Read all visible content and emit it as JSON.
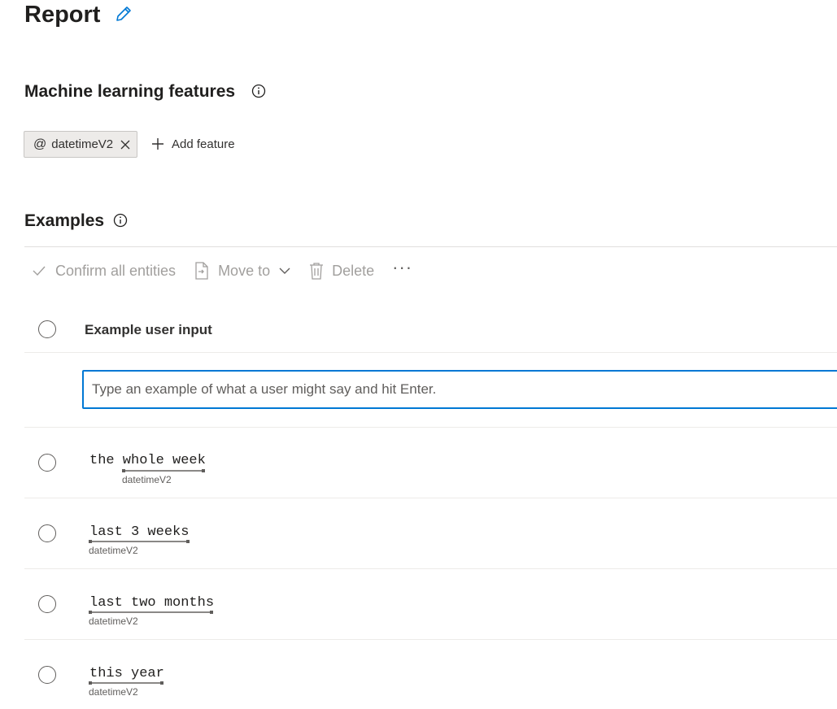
{
  "header": {
    "title": "Report"
  },
  "features": {
    "title": "Machine learning features",
    "chips": [
      {
        "prefix": "@",
        "label": "datetimeV2"
      }
    ],
    "add_label": "Add feature"
  },
  "examples": {
    "title": "Examples",
    "toolbar": {
      "confirm_label": "Confirm all entities",
      "move_label": "Move to",
      "delete_label": "Delete",
      "more_label": "···"
    },
    "column_header": "Example user input",
    "input_placeholder": "Type an example of what a user might say and hit Enter.",
    "rows": [
      {
        "text": "the whole week",
        "entity_text": "whole week",
        "entity": "datetimeV2"
      },
      {
        "text": "last 3 weeks",
        "entity_text": "last 3 weeks",
        "entity": "datetimeV2"
      },
      {
        "text": "last two months",
        "entity_text": "last two months",
        "entity": "datetimeV2"
      },
      {
        "text": "this year",
        "entity_text": "this year",
        "entity": "datetimeV2"
      }
    ]
  },
  "colors": {
    "accent": "#0078d4",
    "disabled": "#a19f9d"
  }
}
